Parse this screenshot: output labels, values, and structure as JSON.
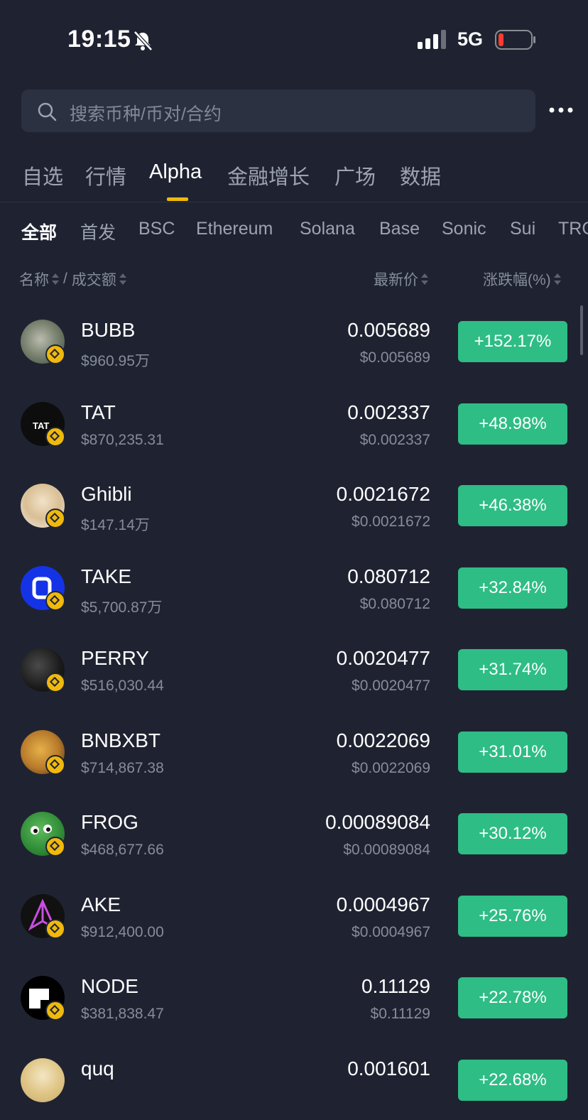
{
  "status_bar": {
    "time": "19:15",
    "network": "5G"
  },
  "search": {
    "placeholder": "搜索币种/币对/合约"
  },
  "tabs": [
    "自选",
    "行情",
    "Alpha",
    "金融增长",
    "广场",
    "数据"
  ],
  "chain_filters": [
    "全部",
    "首发",
    "BSC",
    "Ethereum",
    "Solana",
    "Base",
    "Sonic",
    "Sui",
    "TRC"
  ],
  "columns": {
    "name": "名称",
    "sep": "/",
    "volume": "成交额",
    "price": "最新价",
    "change": "涨跌幅(%)"
  },
  "colors": {
    "background": "#1f2331",
    "positive": "#2ebd85",
    "accent": "#f0b90b"
  },
  "tokens": [
    {
      "symbol": "BUBB",
      "volume": "$960.95万",
      "price": "0.005689",
      "price_usd": "$0.005689",
      "change": "+152.17%",
      "icon": "bubb-avatar"
    },
    {
      "symbol": "TAT",
      "volume": "$870,235.31",
      "price": "0.002337",
      "price_usd": "$0.002337",
      "change": "+48.98%",
      "icon": "tat-avatar"
    },
    {
      "symbol": "Ghibli",
      "volume": "$147.14万",
      "price": "0.0021672",
      "price_usd": "$0.0021672",
      "change": "+46.38%",
      "icon": "ghibli-avatar"
    },
    {
      "symbol": "TAKE",
      "volume": "$5,700.87万",
      "price": "0.080712",
      "price_usd": "$0.080712",
      "change": "+32.84%",
      "icon": "take-avatar"
    },
    {
      "symbol": "PERRY",
      "volume": "$516,030.44",
      "price": "0.0020477",
      "price_usd": "$0.0020477",
      "change": "+31.74%",
      "icon": "perry-avatar"
    },
    {
      "symbol": "BNBXBT",
      "volume": "$714,867.38",
      "price": "0.0022069",
      "price_usd": "$0.0022069",
      "change": "+31.01%",
      "icon": "bnbxbt-avatar"
    },
    {
      "symbol": "FROG",
      "volume": "$468,677.66",
      "price": "0.00089084",
      "price_usd": "$0.00089084",
      "change": "+30.12%",
      "icon": "frog-avatar"
    },
    {
      "symbol": "AKE",
      "volume": "$912,400.00",
      "price": "0.0004967",
      "price_usd": "$0.0004967",
      "change": "+25.76%",
      "icon": "ake-avatar"
    },
    {
      "symbol": "NODE",
      "volume": "$381,838.47",
      "price": "0.11129",
      "price_usd": "$0.11129",
      "change": "+22.78%",
      "icon": "node-avatar"
    },
    {
      "symbol": "quq",
      "volume": "",
      "price": "0.001601",
      "price_usd": "",
      "change": "+22.68%",
      "icon": "quq-avatar"
    }
  ]
}
